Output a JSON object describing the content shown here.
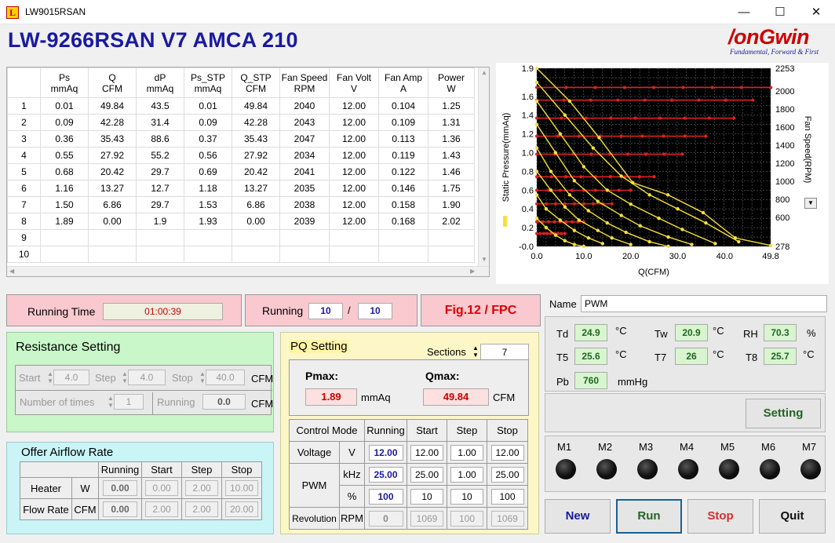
{
  "window": {
    "title": "LW9015RSAN",
    "minimize": "—",
    "maximize": "☐",
    "close": "✕"
  },
  "header": {
    "title": "LW-9266RSAN V7 AMCA 210",
    "logo_main": "/onGwin",
    "logo_tag": "Fundamental, Forward & First"
  },
  "table": {
    "columns": [
      [
        "Ps",
        "mmAq"
      ],
      [
        "Q",
        "CFM"
      ],
      [
        "dP",
        "mmAq"
      ],
      [
        "Ps_STP",
        "mmAq"
      ],
      [
        "Q_STP",
        "CFM"
      ],
      [
        "Fan Speed",
        "RPM"
      ],
      [
        "Fan Volt",
        "V"
      ],
      [
        "Fan Amp",
        "A"
      ],
      [
        "Power",
        "W"
      ]
    ],
    "rows": [
      [
        "1",
        "0.01",
        "49.84",
        "43.5",
        "0.01",
        "49.84",
        "2040",
        "12.00",
        "0.104",
        "1.25"
      ],
      [
        "2",
        "0.09",
        "42.28",
        "31.4",
        "0.09",
        "42.28",
        "2043",
        "12.00",
        "0.109",
        "1.31"
      ],
      [
        "3",
        "0.36",
        "35.43",
        "88.6",
        "0.37",
        "35.43",
        "2047",
        "12.00",
        "0.113",
        "1.36"
      ],
      [
        "4",
        "0.55",
        "27.92",
        "55.2",
        "0.56",
        "27.92",
        "2034",
        "12.00",
        "0.119",
        "1.43"
      ],
      [
        "5",
        "0.68",
        "20.42",
        "29.7",
        "0.69",
        "20.42",
        "2041",
        "12.00",
        "0.122",
        "1.46"
      ],
      [
        "6",
        "1.16",
        "13.27",
        "12.7",
        "1.18",
        "13.27",
        "2035",
        "12.00",
        "0.146",
        "1.75"
      ],
      [
        "7",
        "1.50",
        "6.86",
        "29.7",
        "1.53",
        "6.86",
        "2038",
        "12.00",
        "0.158",
        "1.90"
      ],
      [
        "8",
        "1.89",
        "0.00",
        "1.9",
        "1.93",
        "0.00",
        "2039",
        "12.00",
        "0.168",
        "2.02"
      ],
      [
        "9",
        "",
        "",
        "",
        "",
        "",
        "",
        "",
        "",
        ""
      ],
      [
        "10",
        "",
        "",
        "",
        "",
        "",
        "",
        "",
        "",
        ""
      ]
    ]
  },
  "chart_data": {
    "type": "line",
    "xlabel": "Q(CFM)",
    "ylabel": "Static Pressure(mmAq)",
    "y2label": "Fan Speed(RPM)",
    "xlim": [
      0,
      49.8
    ],
    "ylim": [
      -0.0,
      1.9
    ],
    "y2lim": [
      278,
      2253
    ],
    "x_ticks": [
      "0.0",
      "10.0",
      "20.0",
      "30.0",
      "40.0",
      "49.8"
    ],
    "y_ticks": [
      "-0.0",
      "0.2",
      "0.4",
      "0.6",
      "0.8",
      "1.0",
      "1.2",
      "1.4",
      "1.6",
      "1.9"
    ],
    "y2_ticks": [
      "278",
      "600",
      "800",
      "1000",
      "1200",
      "1400",
      "1600",
      "1800",
      "2000",
      "2253"
    ],
    "grid": true,
    "background": "#000000",
    "pq_series_color": "#f5e03a",
    "rpm_series_color": "#e02020",
    "series": [
      {
        "values": [
          [
            0,
            1.9
          ],
          [
            7,
            1.55
          ],
          [
            13.27,
            1.16
          ],
          [
            20.42,
            0.68
          ],
          [
            27.92,
            0.55
          ],
          [
            35.43,
            0.36
          ],
          [
            42.28,
            0.09
          ],
          [
            49.84,
            0.01
          ]
        ]
      },
      {
        "values": [
          [
            0,
            1.75
          ],
          [
            6,
            1.4
          ],
          [
            12,
            1.05
          ],
          [
            18,
            0.75
          ],
          [
            24,
            0.55
          ],
          [
            30,
            0.4
          ],
          [
            36,
            0.25
          ],
          [
            43,
            0.05
          ]
        ]
      },
      {
        "values": [
          [
            0,
            1.55
          ],
          [
            5,
            1.2
          ],
          [
            10,
            0.85
          ],
          [
            15,
            0.6
          ],
          [
            20,
            0.45
          ],
          [
            26,
            0.3
          ],
          [
            31,
            0.18
          ],
          [
            38,
            0.03
          ]
        ]
      },
      {
        "values": [
          [
            0,
            1.3
          ],
          [
            4,
            1.0
          ],
          [
            8,
            0.7
          ],
          [
            13,
            0.48
          ],
          [
            18,
            0.33
          ],
          [
            22,
            0.22
          ],
          [
            28,
            0.1
          ],
          [
            33,
            0.02
          ]
        ]
      },
      {
        "values": [
          [
            0,
            1.05
          ],
          [
            3,
            0.8
          ],
          [
            7,
            0.55
          ],
          [
            11,
            0.38
          ],
          [
            15,
            0.25
          ],
          [
            19,
            0.15
          ],
          [
            24,
            0.05
          ],
          [
            28,
            0.0
          ]
        ]
      },
      {
        "values": [
          [
            0,
            0.8
          ],
          [
            3,
            0.6
          ],
          [
            6,
            0.42
          ],
          [
            9,
            0.28
          ],
          [
            13,
            0.17
          ],
          [
            16,
            0.09
          ],
          [
            20,
            0.02
          ]
        ]
      },
      {
        "values": [
          [
            0,
            0.55
          ],
          [
            2,
            0.4
          ],
          [
            5,
            0.28
          ],
          [
            8,
            0.17
          ],
          [
            11,
            0.09
          ],
          [
            14,
            0.03
          ]
        ]
      },
      {
        "values": [
          [
            0,
            0.3
          ],
          [
            2,
            0.2
          ],
          [
            4,
            0.12
          ],
          [
            6,
            0.06
          ],
          [
            8,
            0.02
          ],
          [
            10,
            0.0
          ]
        ]
      }
    ],
    "rpm_series": [
      {
        "y": 2040,
        "x_end": 49.84
      },
      {
        "y": 1900,
        "x_end": 46
      },
      {
        "y": 1700,
        "x_end": 42
      },
      {
        "y": 1500,
        "x_end": 36
      },
      {
        "y": 1300,
        "x_end": 31
      },
      {
        "y": 1050,
        "x_end": 25
      },
      {
        "y": 900,
        "x_end": 20
      },
      {
        "y": 750,
        "x_end": 16
      },
      {
        "y": 550,
        "x_end": 10
      },
      {
        "y": 420,
        "x_end": 6
      }
    ]
  },
  "status": {
    "running_time_label": "Running Time",
    "running_time": "01:00:39",
    "running_label": "Running",
    "running_current": "10",
    "running_sep": "/",
    "running_total": "10",
    "fig": "Fig.12 / FPC"
  },
  "resistance": {
    "title": "Resistance Setting",
    "start_label": "Start",
    "start": "4.0",
    "step_label": "Step",
    "step": "4.0",
    "stop_label": "Stop",
    "stop": "40.0",
    "unit": "CFM",
    "times_label": "Number of times",
    "times": "1",
    "running_label": "Running",
    "running": "0.0",
    "unit2": "CFM"
  },
  "airflow": {
    "title": "Offer Airflow Rate",
    "headers": [
      "Running",
      "Start",
      "Step",
      "Stop"
    ],
    "heater_label": "Heater",
    "heater_unit": "W",
    "heater": [
      "0.00",
      "0.00",
      "2.00",
      "10.00"
    ],
    "flow_label": "Flow Rate",
    "flow_unit": "CFM",
    "flow": [
      "0.00",
      "2.00",
      "2.00",
      "20.00"
    ]
  },
  "pq": {
    "title": "PQ Setting",
    "sections_label": "Sections",
    "sections": "7",
    "pmax_label": "Pmax:",
    "pmax": "1.89",
    "pmax_unit": "mmAq",
    "qmax_label": "Qmax:",
    "qmax": "49.84",
    "qmax_unit": "CFM",
    "headers": [
      "Control Mode",
      "Running",
      "Start",
      "Step",
      "Stop"
    ],
    "voltage_label": "Voltage",
    "voltage_unit": "V",
    "voltage": [
      "12.00",
      "12.00",
      "1.00",
      "12.00"
    ],
    "pwm_label": "PWM",
    "pwm_khz_unit": "kHz",
    "pwm_khz": [
      "25.00",
      "25.00",
      "1.00",
      "25.00"
    ],
    "pwm_pct_unit": "%",
    "pwm_pct": [
      "100",
      "10",
      "10",
      "100"
    ],
    "rev_label": "Revolution",
    "rev_unit": "RPM",
    "rev": [
      "0",
      "1069",
      "100",
      "1069"
    ]
  },
  "env": {
    "name_label": "Name",
    "name_value": "PWM",
    "td_label": "Td",
    "td": "24.9",
    "td_unit": "°C",
    "tw_label": "Tw",
    "tw": "20.9",
    "tw_unit": "°C",
    "rh_label": "RH",
    "rh": "70.3",
    "rh_unit": "%",
    "t5_label": "T5",
    "t5": "25.6",
    "t5_unit": "°C",
    "t7_label": "T7",
    "t7": "26",
    "t7_unit": "°C",
    "t8_label": "T8",
    "t8": "25.7",
    "t8_unit": "°C",
    "pb_label": "Pb",
    "pb": "760",
    "pb_unit": "mmHg",
    "setting_label": "Setting"
  },
  "motors": [
    "M1",
    "M2",
    "M3",
    "M4",
    "M5",
    "M6",
    "M7"
  ],
  "buttons": {
    "new": "New",
    "run": "Run",
    "stop": "Stop",
    "quit": "Quit"
  }
}
